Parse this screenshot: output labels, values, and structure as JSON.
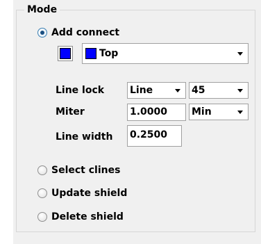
{
  "group": {
    "title": "Mode"
  },
  "modes": {
    "add_connect": {
      "label": "Add connect",
      "checked": true
    },
    "select_clines": {
      "label": "Select clines",
      "checked": false
    },
    "update_shield": {
      "label": "Update shield",
      "checked": false
    },
    "delete_shield": {
      "label": "Delete shield",
      "checked": false
    }
  },
  "layer": {
    "color": "#0000ff",
    "selected": "Top"
  },
  "line_lock": {
    "label": "Line lock",
    "type_selected": "Line",
    "angle_selected": "45"
  },
  "miter": {
    "label": "Miter",
    "value": "1.0000",
    "mode_selected": "Min"
  },
  "line_width": {
    "label": "Line width",
    "value": "0.2500"
  },
  "colors": {
    "panel_background": "#f0f0f0",
    "group_border": "#d6d6d6",
    "layer_color": "#0000ff"
  }
}
